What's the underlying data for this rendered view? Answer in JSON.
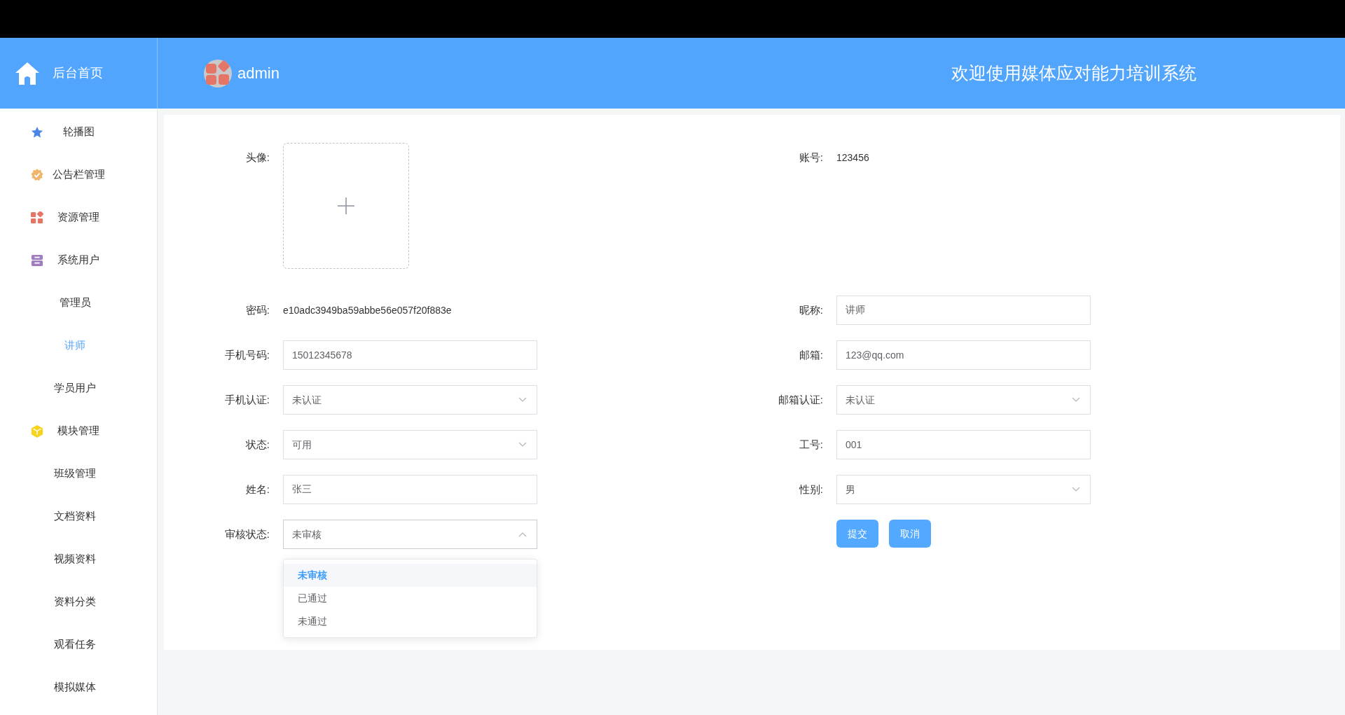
{
  "header": {
    "home_label": "后台首页",
    "user": "admin",
    "title": "欢迎使用媒体应对能力培训系统"
  },
  "sidebar": {
    "items": [
      {
        "label": "轮播图",
        "selected": false
      },
      {
        "label": "公告栏管理",
        "selected": false
      },
      {
        "label": "资源管理",
        "selected": false
      },
      {
        "label": "系统用户",
        "selected": false,
        "children": [
          {
            "label": "管理员",
            "selected": false
          },
          {
            "label": "讲师",
            "selected": true
          },
          {
            "label": "学员用户",
            "selected": false
          }
        ]
      },
      {
        "label": "模块管理",
        "selected": false,
        "children": [
          {
            "label": "班级管理",
            "selected": false
          },
          {
            "label": "文档资料",
            "selected": false
          },
          {
            "label": "视频资料",
            "selected": false
          },
          {
            "label": "资料分类",
            "selected": false
          },
          {
            "label": "观看任务",
            "selected": false
          },
          {
            "label": "模拟媒体",
            "selected": false
          }
        ]
      }
    ]
  },
  "form": {
    "left": [
      {
        "kind": "upload",
        "label": "头像:"
      },
      {
        "kind": "text",
        "label": "密码:",
        "value": "e10adc3949ba59abbe56e057f20f883e"
      },
      {
        "kind": "input",
        "label": "手机号码:",
        "value": "15012345678"
      },
      {
        "kind": "select",
        "label": "手机认证:",
        "value": "未认证",
        "expanded": false
      },
      {
        "kind": "select",
        "label": "状态:",
        "value": "可用",
        "expanded": false
      },
      {
        "kind": "input",
        "label": "姓名:",
        "value": "张三"
      },
      {
        "kind": "select",
        "label": "审核状态:",
        "value": "未审核",
        "expanded": true,
        "options": [
          {
            "label": "未审核",
            "selected": true
          },
          {
            "label": "已通过",
            "selected": false
          },
          {
            "label": "未通过",
            "selected": false
          }
        ]
      }
    ],
    "right": [
      {
        "kind": "text",
        "label": "账号:",
        "value": "123456"
      },
      {
        "kind": "input",
        "label": "昵称:",
        "value": "讲师"
      },
      {
        "kind": "input",
        "label": "邮箱:",
        "value": "123@qq.com"
      },
      {
        "kind": "select",
        "label": "邮箱认证:",
        "value": "未认证",
        "expanded": false
      },
      {
        "kind": "input",
        "label": "工号:",
        "value": "001"
      },
      {
        "kind": "select",
        "label": "性别:",
        "value": "男",
        "expanded": false
      },
      {
        "kind": "buttons",
        "buttons": [
          "提交",
          "取消"
        ]
      }
    ]
  }
}
